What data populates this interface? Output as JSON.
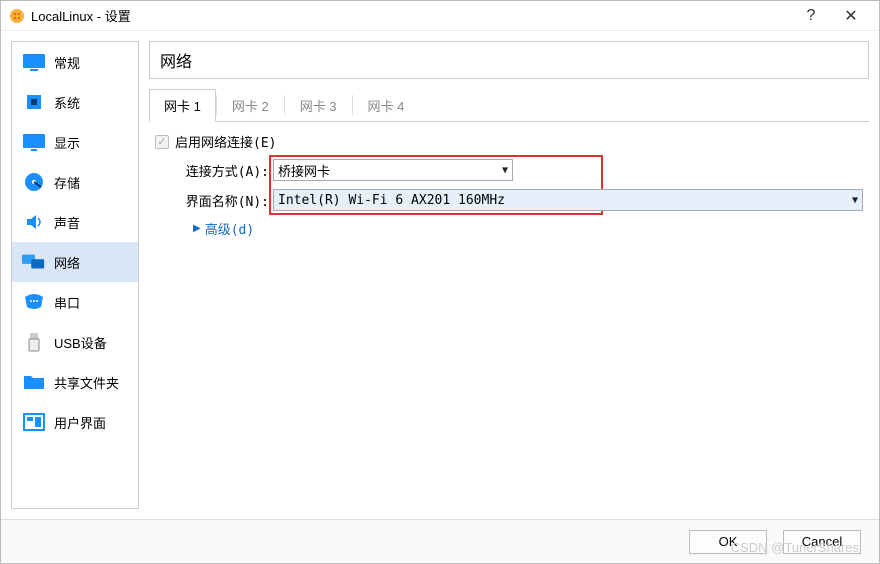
{
  "titlebar": {
    "app_name": "LocalLinux - 设置",
    "help_glyph": "?",
    "close_glyph": "✕"
  },
  "sidebar": {
    "items": [
      {
        "label": "常规",
        "icon": "monitor-icon",
        "color": "#1a90ff"
      },
      {
        "label": "系统",
        "icon": "chip-icon",
        "color": "#1a90ff"
      },
      {
        "label": "显示",
        "icon": "display-icon",
        "color": "#1a90ff"
      },
      {
        "label": "存储",
        "icon": "disk-icon",
        "color": "#1a90ff"
      },
      {
        "label": "声音",
        "icon": "speaker-icon",
        "color": "#1a90ff"
      },
      {
        "label": "网络",
        "icon": "network-icon",
        "color": "#1a90ff",
        "active": true
      },
      {
        "label": "串口",
        "icon": "serial-icon",
        "color": "#1a90ff"
      },
      {
        "label": "USB设备",
        "icon": "usb-icon",
        "color": "#888"
      },
      {
        "label": "共享文件夹",
        "icon": "folder-icon",
        "color": "#1a90ff"
      },
      {
        "label": "用户界面",
        "icon": "ui-icon",
        "color": "#1a90ff"
      }
    ]
  },
  "main": {
    "page_title": "网络",
    "tabs": [
      {
        "label": "网卡 1",
        "active": true
      },
      {
        "label": "网卡 2"
      },
      {
        "label": "网卡 3"
      },
      {
        "label": "网卡 4"
      }
    ],
    "enable_label": "启用网络连接(E)",
    "enable_checked": true,
    "attach_label": "连接方式(A):",
    "attach_value": "桥接网卡",
    "iface_label": "界面名称(N):",
    "iface_value": "Intel(R) Wi-Fi 6 AX201 160MHz",
    "advanced_label": "高级(d)"
  },
  "footer": {
    "ok": "OK",
    "cancel": "Cancel"
  },
  "watermark": "CSDN @TunerShares"
}
